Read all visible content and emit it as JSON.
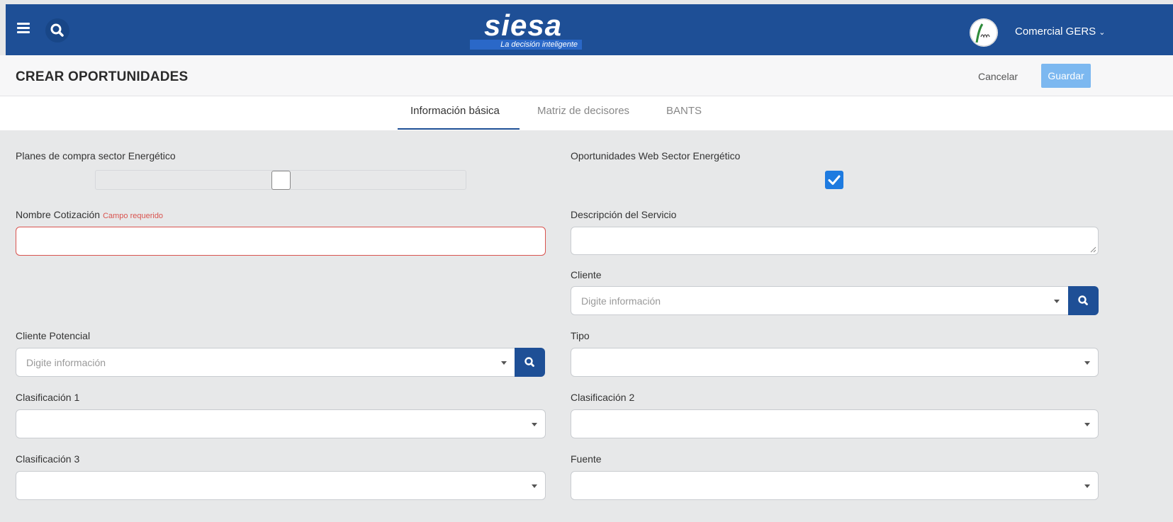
{
  "topbar": {
    "brand_name": "siesa",
    "brand_tagline": "La decisión inteligente",
    "user_name": "Comercial GERS",
    "menu_icon": "hamburger-icon",
    "search_icon": "search-icon"
  },
  "header": {
    "title": "CREAR OPORTUNIDADES",
    "cancel_label": "Cancelar",
    "save_label": "Guardar"
  },
  "tabs": [
    {
      "label": "Información básica",
      "active": true
    },
    {
      "label": "Matriz de decisores",
      "active": false
    },
    {
      "label": "BANTS",
      "active": false
    }
  ],
  "form": {
    "planes_compra": {
      "label": "Planes de compra sector Energético",
      "checked": false
    },
    "oportunidades_web": {
      "label": "Oportunidades Web Sector Energético",
      "checked": true
    },
    "nombre_cotizacion": {
      "label": "Nombre Cotización",
      "required_text": "Campo requerido",
      "value": ""
    },
    "descripcion_servicio": {
      "label": "Descripción del Servicio",
      "value": ""
    },
    "cliente": {
      "label": "Cliente",
      "placeholder": "Digite información"
    },
    "cliente_potencial": {
      "label": "Cliente Potencial",
      "placeholder": "Digite información"
    },
    "tipo": {
      "label": "Tipo",
      "value": ""
    },
    "clasificacion_1": {
      "label": "Clasificación 1",
      "value": ""
    },
    "clasificacion_2": {
      "label": "Clasificación 2",
      "value": ""
    },
    "clasificacion_3": {
      "label": "Clasificación 3",
      "value": ""
    },
    "fuente": {
      "label": "Fuente",
      "value": ""
    }
  },
  "colors": {
    "primary": "#1e4f96",
    "save_button": "#7cb8f0",
    "error": "#d9534f",
    "checkbox_on": "#1e7be0"
  }
}
